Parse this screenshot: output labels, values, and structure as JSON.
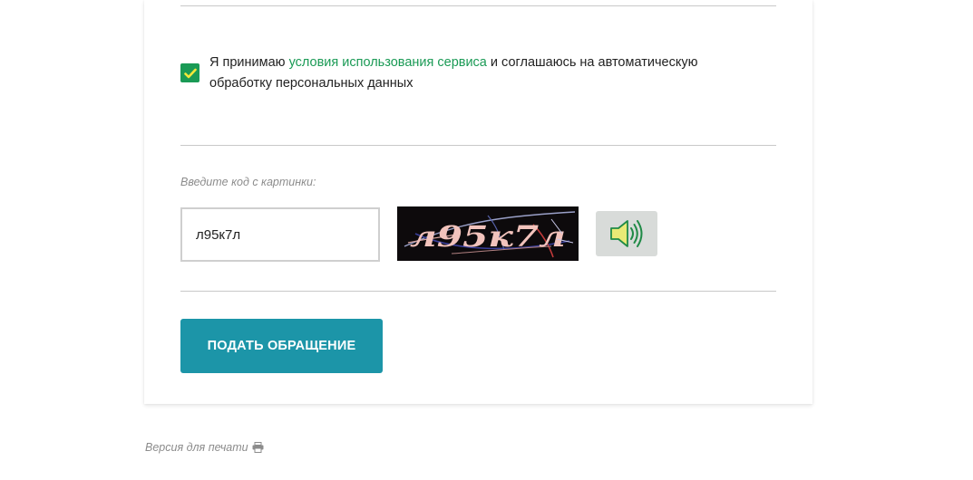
{
  "form": {
    "consent": {
      "checked": true,
      "text_before": "Я принимаю ",
      "link_text": "условия использования сервиса",
      "text_after": " и соглашаюсь на автоматическую обработку персональных данных"
    },
    "captcha": {
      "label": "Введите код с картинки:",
      "value": "л95к7л",
      "image_text": "л95к7л"
    },
    "audio_icon": "speaker-icon",
    "submit_label": "ПОДАТЬ ОБРАЩЕНИЕ"
  },
  "footer": {
    "print_label": "Версия для печати",
    "print_icon": "printer-icon"
  },
  "colors": {
    "accent_green": "#1a9a55",
    "button_teal": "#1c95a8",
    "audio_bg": "#d8dbd9",
    "label_gray": "#8c8c8c"
  }
}
